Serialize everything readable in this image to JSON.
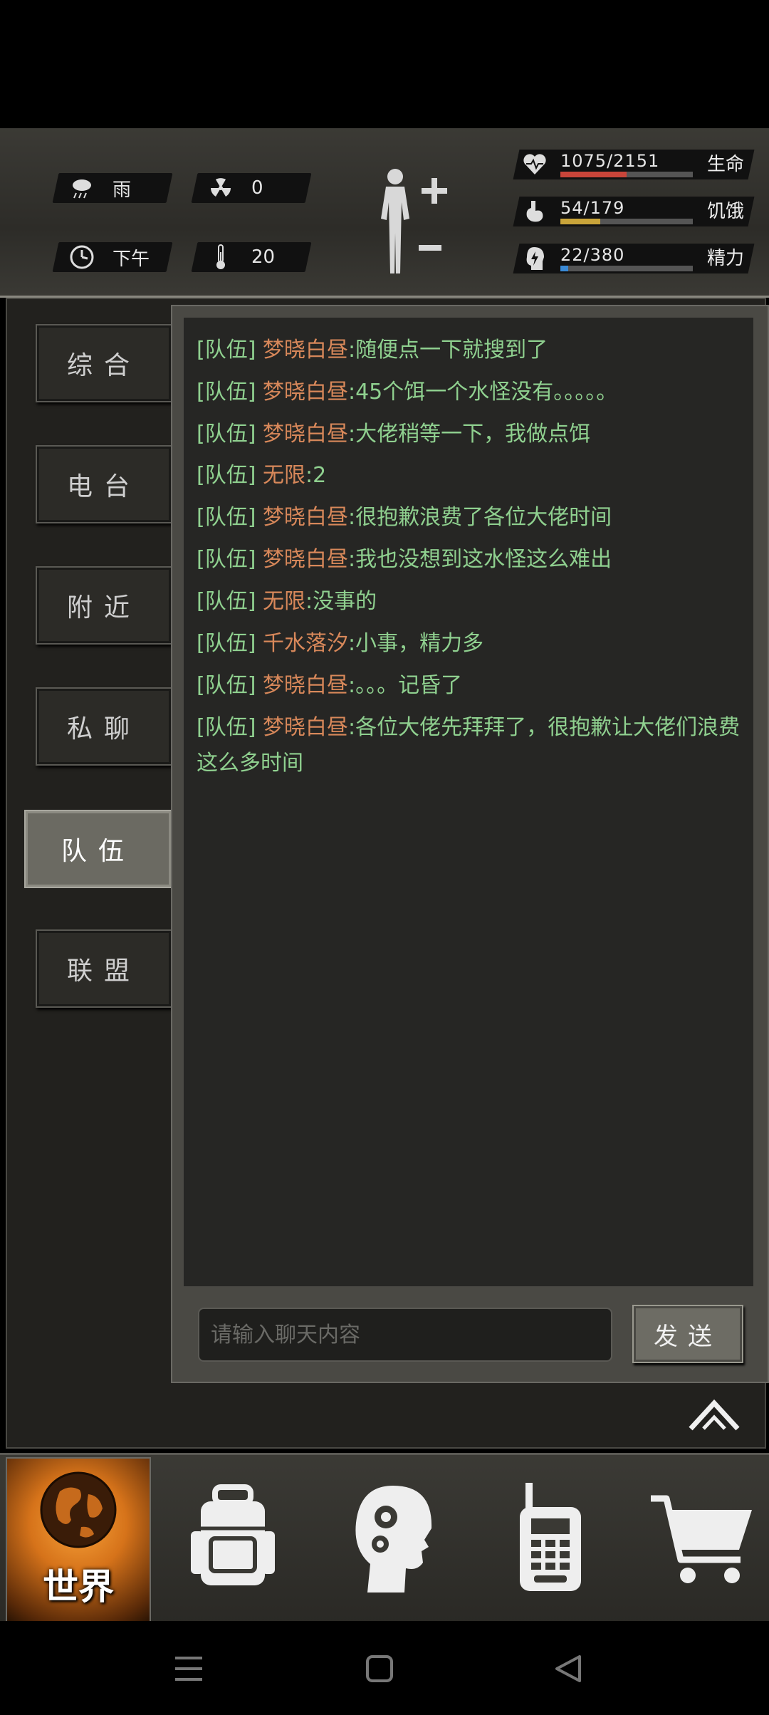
{
  "status": {
    "weather": "雨",
    "radiation": "0",
    "time_of_day": "下午",
    "temperature": "20"
  },
  "vitals": [
    {
      "key": "health",
      "current": "1075/2151",
      "label": "生命",
      "fraction": 0.5,
      "color": "#c9453a",
      "icon": "heart-pulse-icon"
    },
    {
      "key": "hunger",
      "current": "54/179",
      "label": "饥饿",
      "fraction": 0.3,
      "color": "#c9a43a",
      "icon": "stomach-icon"
    },
    {
      "key": "energy",
      "current": "22/380",
      "label": "精力",
      "fraction": 0.06,
      "color": "#3a8ad6",
      "icon": "head-bolt-icon"
    }
  ],
  "tabs": [
    {
      "label": "综合",
      "active": false
    },
    {
      "label": "电台",
      "active": false
    },
    {
      "label": "附近",
      "active": false
    },
    {
      "label": "私聊",
      "active": false
    },
    {
      "label": "队伍",
      "active": true
    },
    {
      "label": "联盟",
      "active": false
    }
  ],
  "messages": [
    {
      "tag": "[队伍]",
      "name": "梦晓白昼",
      "text": ":随便点一下就搜到了"
    },
    {
      "tag": "[队伍]",
      "name": "梦晓白昼",
      "text": ":45个饵一个水怪没有。。。。。"
    },
    {
      "tag": "[队伍]",
      "name": "梦晓白昼",
      "text": ":大佬稍等一下，我做点饵"
    },
    {
      "tag": "[队伍]",
      "name": "无限",
      "text": ":2"
    },
    {
      "tag": "[队伍]",
      "name": "梦晓白昼",
      "text": ":很抱歉浪费了各位大佬时间"
    },
    {
      "tag": "[队伍]",
      "name": "梦晓白昼",
      "text": ":我也没想到这水怪这么难出"
    },
    {
      "tag": "[队伍]",
      "name": "无限",
      "text": ":没事的"
    },
    {
      "tag": "[队伍]",
      "name": "千水落汐",
      "text": ":小事，精力多"
    },
    {
      "tag": "[队伍]",
      "name": "梦晓白昼",
      "text": ":。。。记昏了"
    },
    {
      "tag": "[队伍]",
      "name": "梦晓白昼",
      "text": ":各位大佬先拜拜了，很抱歉让大佬们浪费这么多时间"
    }
  ],
  "chat_input": {
    "placeholder": "请输入聊天内容",
    "value": ""
  },
  "send_label": "发送",
  "bottom_nav": {
    "world_label": "世界"
  },
  "colors": {
    "tag": "#8fd08f",
    "name": "#d8885a",
    "text": "#8fd08f"
  }
}
